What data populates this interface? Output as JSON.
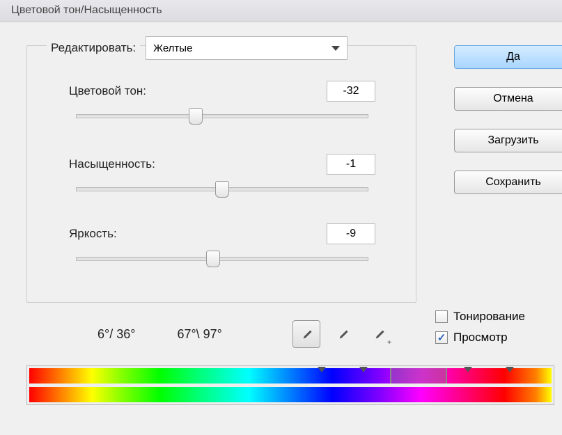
{
  "window": {
    "title": "Цветовой тон/Насыщенность"
  },
  "edit": {
    "label": "Редактировать:",
    "selected": "Желтые"
  },
  "sliders": {
    "hue": {
      "label": "Цветовой тон:",
      "value": "-32",
      "pos": 41
    },
    "saturation": {
      "label": "Насыщенность:",
      "value": "-1",
      "pos": 50
    },
    "lightness": {
      "label": "Яркость:",
      "value": "-9",
      "pos": 47
    }
  },
  "buttons": {
    "ok": "Да",
    "cancel": "Отмена",
    "load": "Загрузить",
    "save": "Сохранить"
  },
  "range": {
    "left": "6°/ 36°",
    "right": "67°\\ 97°"
  },
  "checks": {
    "colorize": {
      "label": "Тонирование",
      "checked": false
    },
    "preview": {
      "label": "Просмотр",
      "checked": true
    }
  },
  "icons": {
    "eyedropper": "eyedropper-icon",
    "eyedropper_plus": "eyedropper-plus-icon",
    "eyedropper_minus": "eyedropper-minus-icon"
  }
}
